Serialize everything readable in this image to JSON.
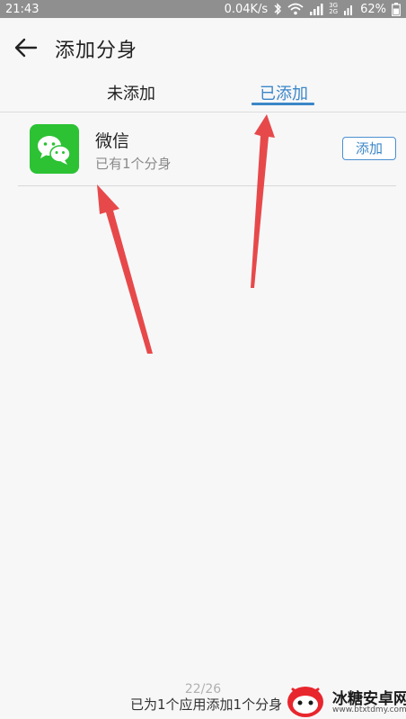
{
  "status_bar": {
    "time": "21:43",
    "speed": "0.04K/s",
    "sim_top": "3G",
    "sim_bottom": "2G",
    "battery": "62%"
  },
  "header": {
    "title": "添加分身",
    "back_icon": "arrow-left-icon"
  },
  "tabs": [
    {
      "label": "未添加",
      "active": false
    },
    {
      "label": "已添加",
      "active": true
    }
  ],
  "accent_color": "#3b86c8",
  "app_list": [
    {
      "icon": "wechat-icon",
      "name": "微信",
      "subtitle": "已有1个分身",
      "button_label": "添加"
    }
  ],
  "footer": {
    "page_counter": "22/26",
    "summary": "已为1个应用添加1个分身"
  },
  "watermark": {
    "title": "冰糖安卓网",
    "url": "www.btxtdmy.com"
  }
}
